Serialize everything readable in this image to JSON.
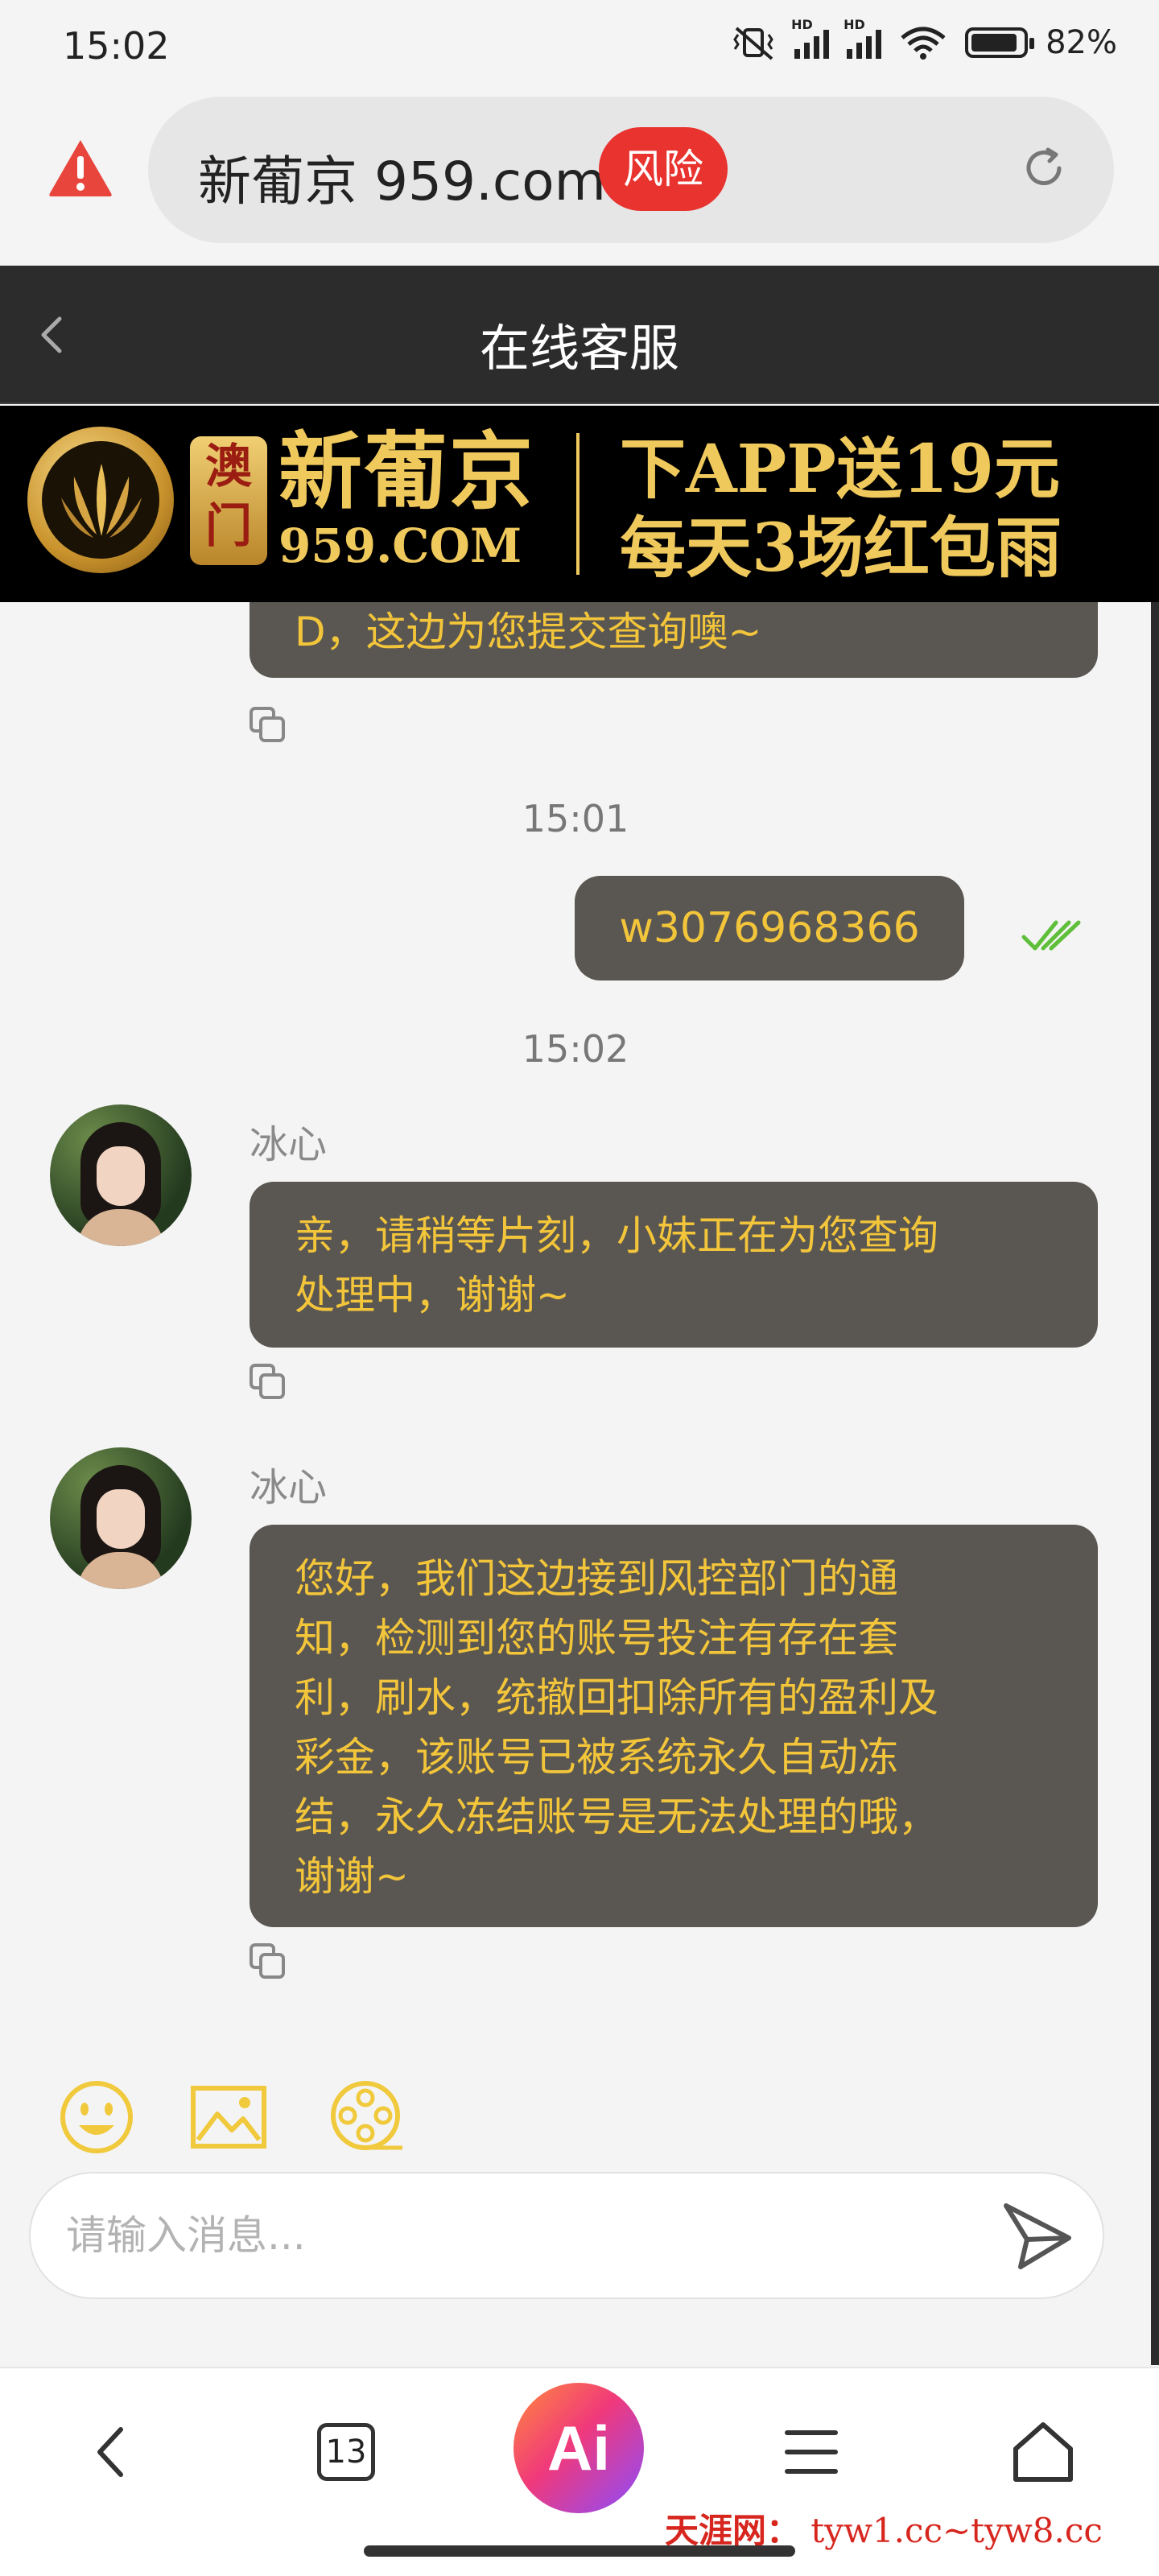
{
  "status_bar": {
    "time": "15:02",
    "battery": "82%",
    "network_labels": [
      "HD",
      "HD"
    ]
  },
  "browser": {
    "url": "新葡京 959.com",
    "risk_badge": "风险"
  },
  "header": {
    "title": "在线客服"
  },
  "banner": {
    "macau": "澳门",
    "brand": "新葡京",
    "domain": "959.COM",
    "promo_line1": "下APP送19元",
    "promo_line2": "每天3场红包雨"
  },
  "chat": {
    "partial_message": "D，这边为您提交查询噢~",
    "timestamp_1": "15:01",
    "user_message": "w3076968366",
    "timestamp_2": "15:02",
    "messages": [
      {
        "sender": "冰心",
        "lines": [
          "亲，请稍等片刻，小妹正在为您查询",
          "处理中，谢谢~"
        ]
      },
      {
        "sender": "冰心",
        "lines": [
          "您好，我们这边接到风控部门的通",
          "知，检测到您的账号投注有存在套",
          "利，刷水，统撤回扣除所有的盈利及",
          "彩金，该账号已被系统永久自动冻",
          "结，永久冻结账号是无法处理的哦，",
          "谢谢~"
        ]
      }
    ]
  },
  "composer": {
    "placeholder": "请输入消息..."
  },
  "bottom_nav": {
    "tab_count": "13",
    "ai_label": "Ai"
  },
  "watermark": {
    "name": "天涯网：",
    "urls": "tyw1.cc~tyw8.cc"
  },
  "colors": {
    "header_bg": "#2c2c2c",
    "bubble_bg": "#5a5752",
    "bubble_text": "#f3c53a",
    "risk_red": "#e8332f",
    "icon_gold": "#f0c93c",
    "check_green": "#5fbf3a"
  }
}
